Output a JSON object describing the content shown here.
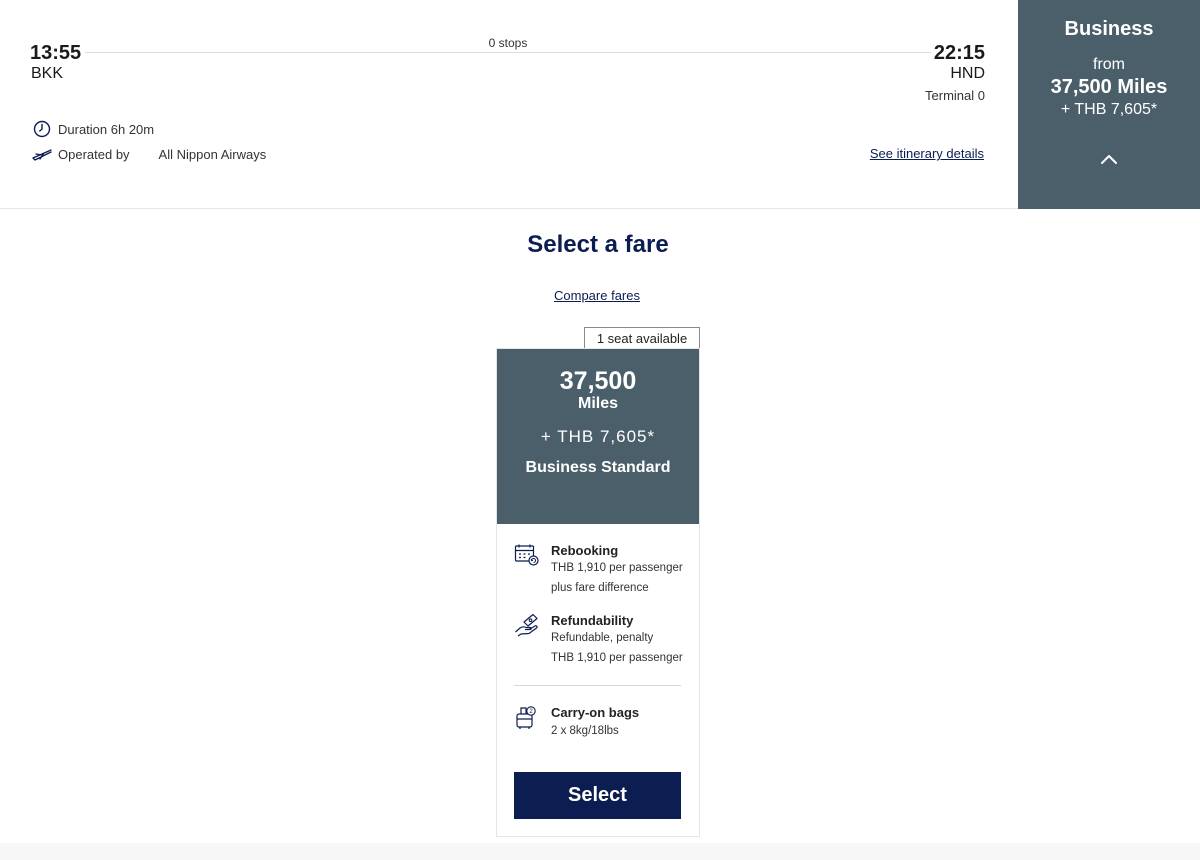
{
  "flight": {
    "departure_time": "13:55",
    "departure_airport": "BKK",
    "stops": "0 stops",
    "arrival_time": "22:15",
    "arrival_airport": "HND",
    "terminal": "Terminal 0",
    "duration": "Duration 6h 20m",
    "operated_by_label": "Operated by",
    "carrier": "All Nippon Airways",
    "itinerary_link": "See itinerary details"
  },
  "cabin": {
    "name": "Business",
    "from_label": "from",
    "miles": "37,500 Miles",
    "cash": "+ THB 7,605*",
    "toggle_icon": "chevron-up-icon"
  },
  "fare_section": {
    "title": "Select a fare",
    "compare_link": "Compare fares"
  },
  "fare": {
    "seats_badge": "1 seat available",
    "miles": "37,500",
    "miles_unit": "Miles",
    "cash": "+ THB 7,605*",
    "name": "Business Standard",
    "rebooking": {
      "title": "Rebooking",
      "line1": "THB 1,910 per passenger",
      "line2": "plus fare difference"
    },
    "refundability": {
      "title": "Refundability",
      "line1": "Refundable, penalty",
      "line2": "THB 1,910 per passenger"
    },
    "carry_on": {
      "title": "Carry-on bags",
      "line1": "2 x 8kg/18lbs"
    },
    "select_label": "Select"
  },
  "colors": {
    "navy": "#0b1d51",
    "slate": "#4b5f6b"
  }
}
